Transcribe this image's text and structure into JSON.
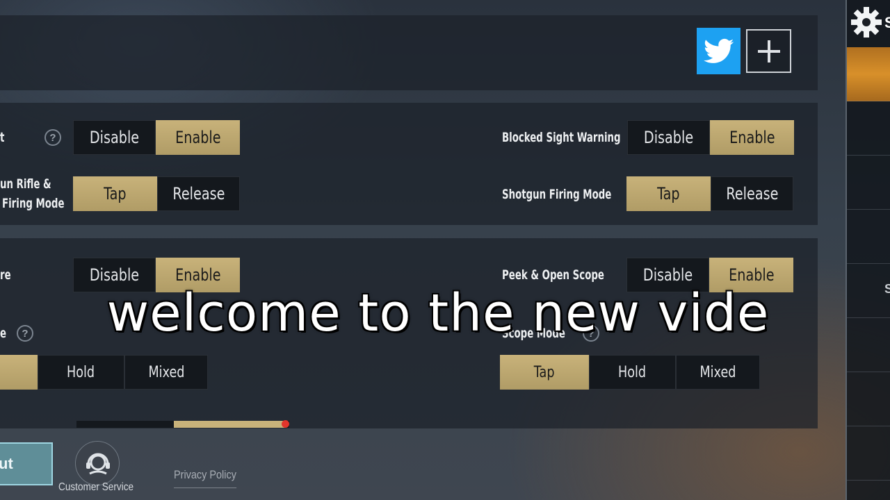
{
  "header": {
    "twitter_icon": "twitter-icon",
    "add_icon": "plus-icon"
  },
  "section1": {
    "left_row1": {
      "label": "t",
      "options": [
        "Disable",
        "Enable"
      ],
      "selected": "Enable"
    },
    "left_row2": {
      "label_line1": "un Rifle &",
      "label_line2": "Firing Mode",
      "options": [
        "Tap",
        "Release"
      ],
      "selected": "Tap"
    },
    "right_row1": {
      "label": "Blocked Sight Warning",
      "options": [
        "Disable",
        "Enable"
      ],
      "selected": "Enable"
    },
    "right_row2": {
      "label": "Shotgun Firing Mode",
      "options": [
        "Tap",
        "Release"
      ],
      "selected": "Tap"
    }
  },
  "section2": {
    "left_row1": {
      "label": "re",
      "options": [
        "Disable",
        "Enable"
      ],
      "selected": "Enable"
    },
    "left_row2": {
      "label": "e",
      "options": [
        "",
        "Hold",
        "Mixed"
      ],
      "selected": ""
    },
    "right_row1": {
      "label": "Peek & Open Scope",
      "options": [
        "Disable",
        "Enable"
      ],
      "selected": "Enable"
    },
    "right_row2": {
      "label": "Scope Mode",
      "options": [
        "Tap",
        "Hold",
        "Mixed"
      ],
      "selected": "Tap"
    }
  },
  "slider": {
    "fill_fraction": 0.54
  },
  "footer": {
    "logout_label": "ut",
    "customer_service_label": "Customer Service",
    "privacy_label": "Privacy Policy"
  },
  "sidebar": {
    "gear_icon": "gear-icon",
    "side_letter": "S"
  },
  "caption": {
    "text": "welcome to the new vide"
  },
  "colors": {
    "accent_gold": "#c8b27a",
    "twitter_blue": "#1da1f2",
    "sidebar_active": "#d8902a",
    "logout_teal": "#5f8e98"
  }
}
